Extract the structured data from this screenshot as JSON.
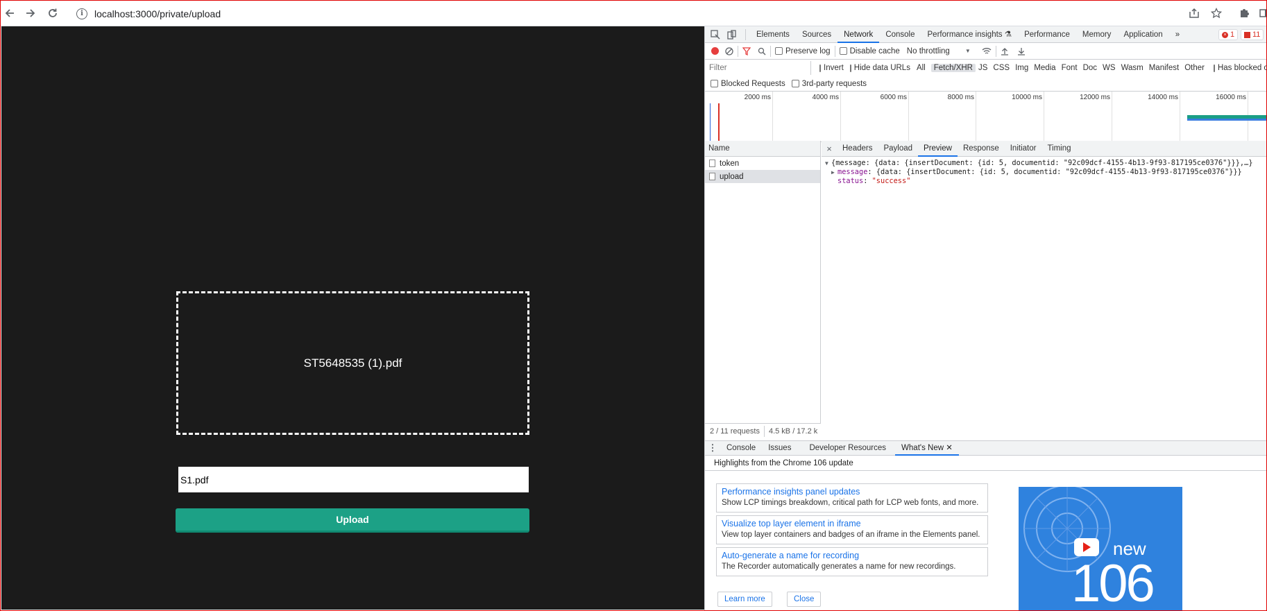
{
  "browser": {
    "url": "localhost:3000/private/upload"
  },
  "app": {
    "dropzone_filename": "ST5648535 (1).pdf",
    "name_input_value": "S1.pdf",
    "upload_label": "Upload"
  },
  "devtools": {
    "tabs": [
      "Elements",
      "Sources",
      "Network",
      "Console",
      "Performance insights",
      "Performance",
      "Memory",
      "Application"
    ],
    "more_tabs": "»",
    "error_count": "1",
    "issue_count": "11",
    "toolbar": {
      "preserve_log": "Preserve log",
      "disable_cache": "Disable cache",
      "throttling": "No throttling"
    },
    "filter": {
      "placeholder": "Filter",
      "invert": "Invert",
      "hide_data_urls": "Hide data URLs",
      "types": [
        "All",
        "Fetch/XHR",
        "JS",
        "CSS",
        "Img",
        "Media",
        "Font",
        "Doc",
        "WS",
        "Wasm",
        "Manifest",
        "Other"
      ],
      "has_blocked": "Has blocked co"
    },
    "blocked_requests": "Blocked Requests",
    "third_party": "3rd-party requests",
    "timeline_ticks": [
      "2000 ms",
      "4000 ms",
      "6000 ms",
      "8000 ms",
      "10000 ms",
      "12000 ms",
      "14000 ms",
      "16000 ms"
    ],
    "name_header": "Name",
    "requests": [
      "token",
      "upload"
    ],
    "status_summary": "2 / 11 requests",
    "transfer_summary": "4.5 kB / 17.2 k",
    "detail_tabs": [
      "Headers",
      "Payload",
      "Preview",
      "Response",
      "Initiator",
      "Timing"
    ],
    "preview": {
      "line1": "{message: {data: {insertDocument: {id: 5, documentid: \"92c09dcf-4155-4b13-9f93-817195ce0376\"}}},…}",
      "message_key": "message",
      "message_value": "{data: {insertDocument: {id: 5, documentid: \"92c09dcf-4155-4b13-9f93-817195ce0376\"}}}",
      "status_key": "status",
      "status_value": "\"success\""
    },
    "drawer_tabs": [
      "Console",
      "Issues",
      "Developer Resources",
      "What's New"
    ],
    "whats_new": {
      "heading": "Highlights from the Chrome 106 update",
      "items": [
        {
          "title": "Performance insights panel updates",
          "desc": "Show LCP timings breakdown, critical path for LCP web fonts, and more."
        },
        {
          "title": "Visualize top layer element in iframe",
          "desc": "View top layer containers and badges of an iframe in the Elements panel."
        },
        {
          "title": "Auto-generate a name for recording",
          "desc": "The Recorder automatically generates a name for new recordings."
        }
      ],
      "learn_more": "Learn more",
      "close": "Close",
      "banner_new": "new",
      "banner_version": "106"
    }
  },
  "colors": {
    "app_bg": "#1b1b1b",
    "upload_button": "#1ca186",
    "devtools_accent": "#1a73e8",
    "banner_bg": "#2f82de"
  }
}
